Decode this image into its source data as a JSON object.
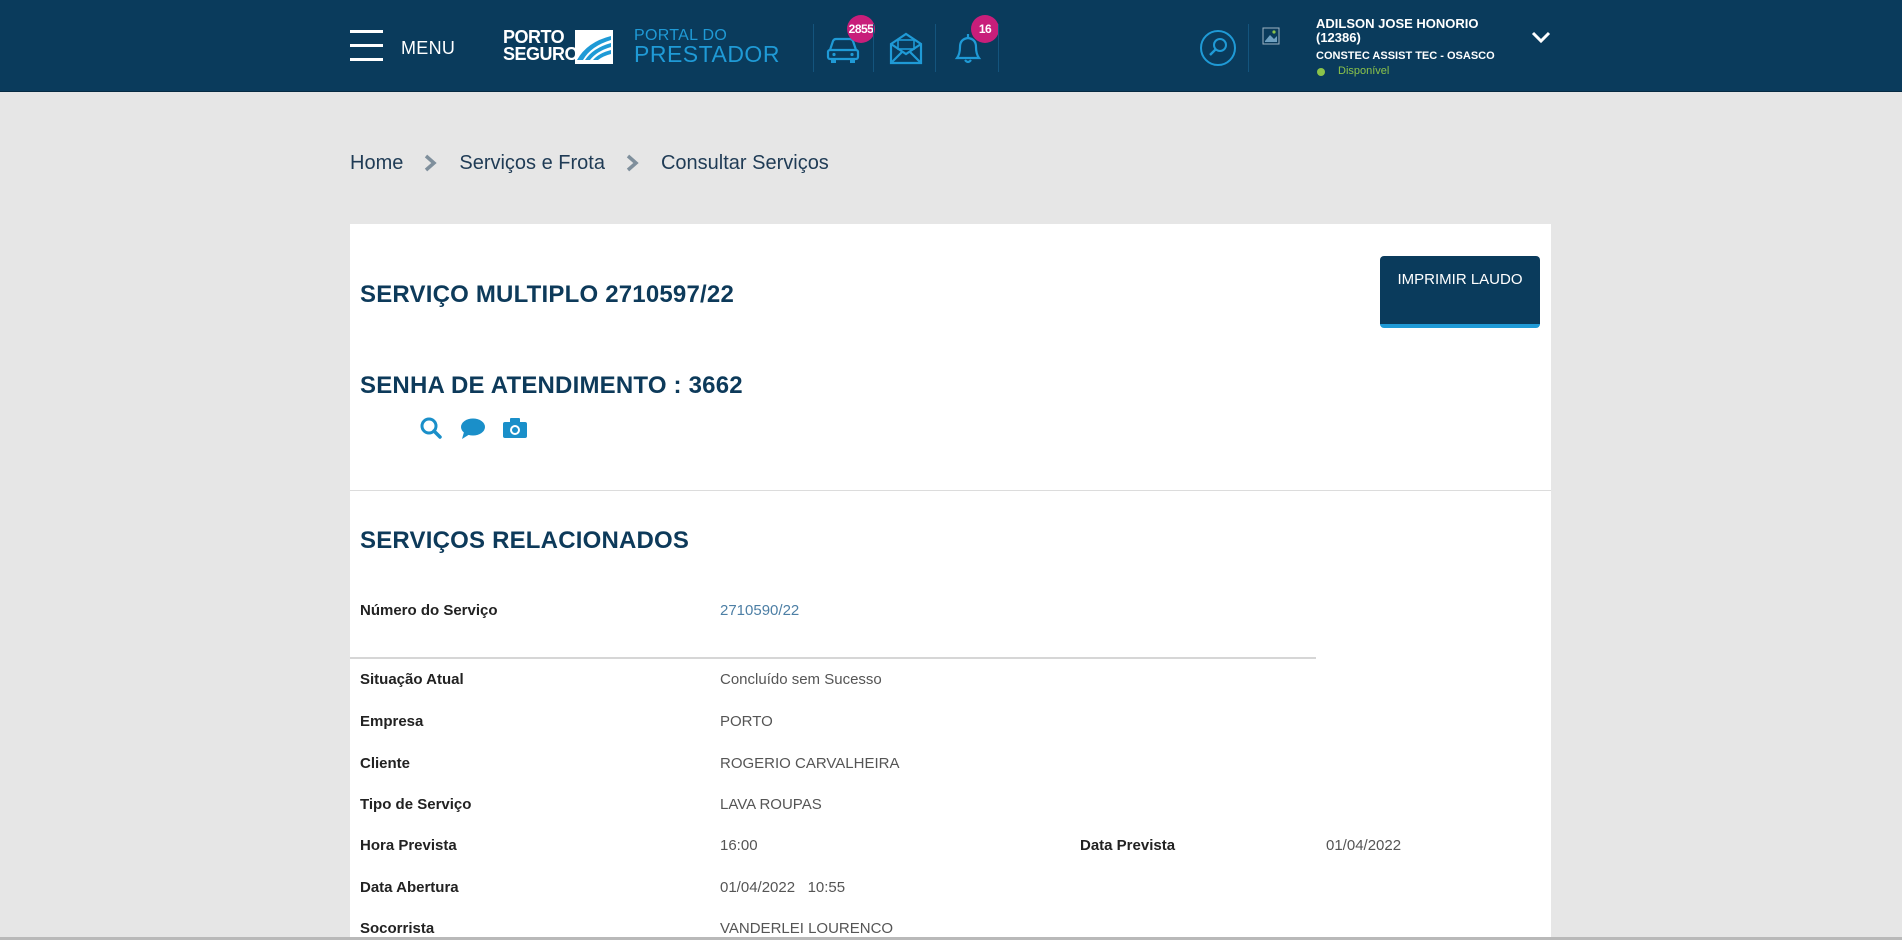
{
  "header": {
    "menu_label": "MENU",
    "logo_line1": "PORTO",
    "logo_line2": "SEGURO",
    "portal_line1": "PORTAL DO",
    "portal_line2": "PRESTADOR",
    "icons": [
      {
        "name": "car-icon",
        "badge": "2855"
      },
      {
        "name": "mail-icon",
        "badge": ""
      },
      {
        "name": "bell-icon",
        "badge": "16"
      }
    ],
    "user_name": "ADILSON JOSE HONORIO (12386)",
    "user_company": "CONSTEC ASSIST TEC - OSASCO",
    "user_status": "Disponível",
    "status_color": "#8bc34a",
    "brand_color": "#0a3b5c",
    "accent_color": "#1f9ad6",
    "badge_color": "#c81e7a"
  },
  "breadcrumb": {
    "items": [
      "Home",
      "Serviços e Frota",
      "Consultar Serviços"
    ]
  },
  "service": {
    "title": "SERVIÇO MULTIPLO 2710597/22",
    "password_title": "SENHA DE ATENDIMENTO : 3662",
    "print_button": "IMPRIMIR LAUDO",
    "action_icons": [
      "search-icon",
      "comment-icon",
      "camera-icon"
    ]
  },
  "related": {
    "title": "SERVIÇOS RELACIONADOS",
    "service_number_label": "Número do Serviço",
    "service_number": "2710590/22",
    "rows": [
      {
        "label": "Situação Atual",
        "value": "Concluído sem Sucesso"
      },
      {
        "label": "Empresa",
        "value": "PORTO"
      },
      {
        "label": "Cliente",
        "value": "ROGERIO CARVALHEIRA"
      },
      {
        "label": "Tipo de Serviço",
        "value": "LAVA ROUPAS"
      },
      {
        "label": "Hora Prevista",
        "value": "16:00",
        "label2": "Data Prevista",
        "value2": "01/04/2022"
      },
      {
        "label": "Data Abertura",
        "value": "01/04/2022   10:55"
      },
      {
        "label": "Socorrista",
        "value": "VANDERLEI LOURENCO"
      }
    ]
  }
}
